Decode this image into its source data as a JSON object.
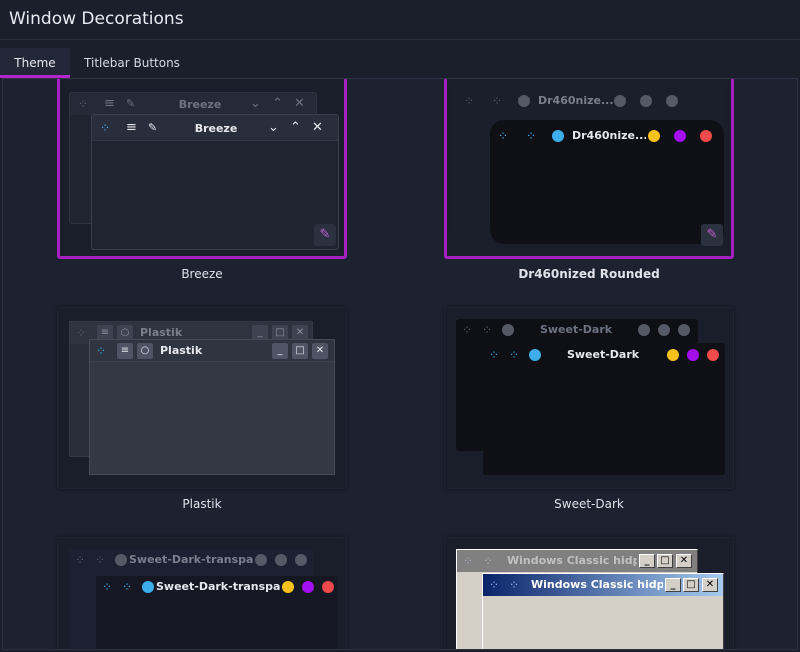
{
  "header": {
    "title": "Window Decorations"
  },
  "tabs": [
    {
      "label": "Theme"
    },
    {
      "label": "Titlebar Buttons"
    }
  ],
  "themes": [
    {
      "name": "Breeze",
      "preview_title": "Breeze",
      "selected": true
    },
    {
      "name": "Dr460nized Rounded",
      "preview_title": "Dr460nize...",
      "selected": true
    },
    {
      "name": "Plastik",
      "preview_title": "Plastik",
      "selected": false
    },
    {
      "name": "Sweet-Dark",
      "preview_title": "Sweet-Dark",
      "selected": false
    },
    {
      "name": "Sweet-Dark-transparent",
      "preview_title": "Sweet-Dark-transpa...",
      "selected": false
    },
    {
      "name": "Windows Classic hidpi",
      "preview_title": "Windows Classic hidpi",
      "selected": false
    }
  ],
  "icons": {
    "app": "diamond-dots-icon",
    "menu": "hamburger-menu-icon",
    "pin": "pin-icon",
    "minimize": "chevron-down-icon",
    "maximize": "chevron-up-icon",
    "close": "close-icon",
    "edit": "edit-pencil-icon"
  },
  "colors": {
    "accent": "#a61fbf",
    "background": "#1b1f2c",
    "traffic_yellow": "#f8c21a",
    "traffic_purple": "#a40ff0",
    "traffic_red": "#f04a4a",
    "accent_blue": "#3daee9"
  }
}
